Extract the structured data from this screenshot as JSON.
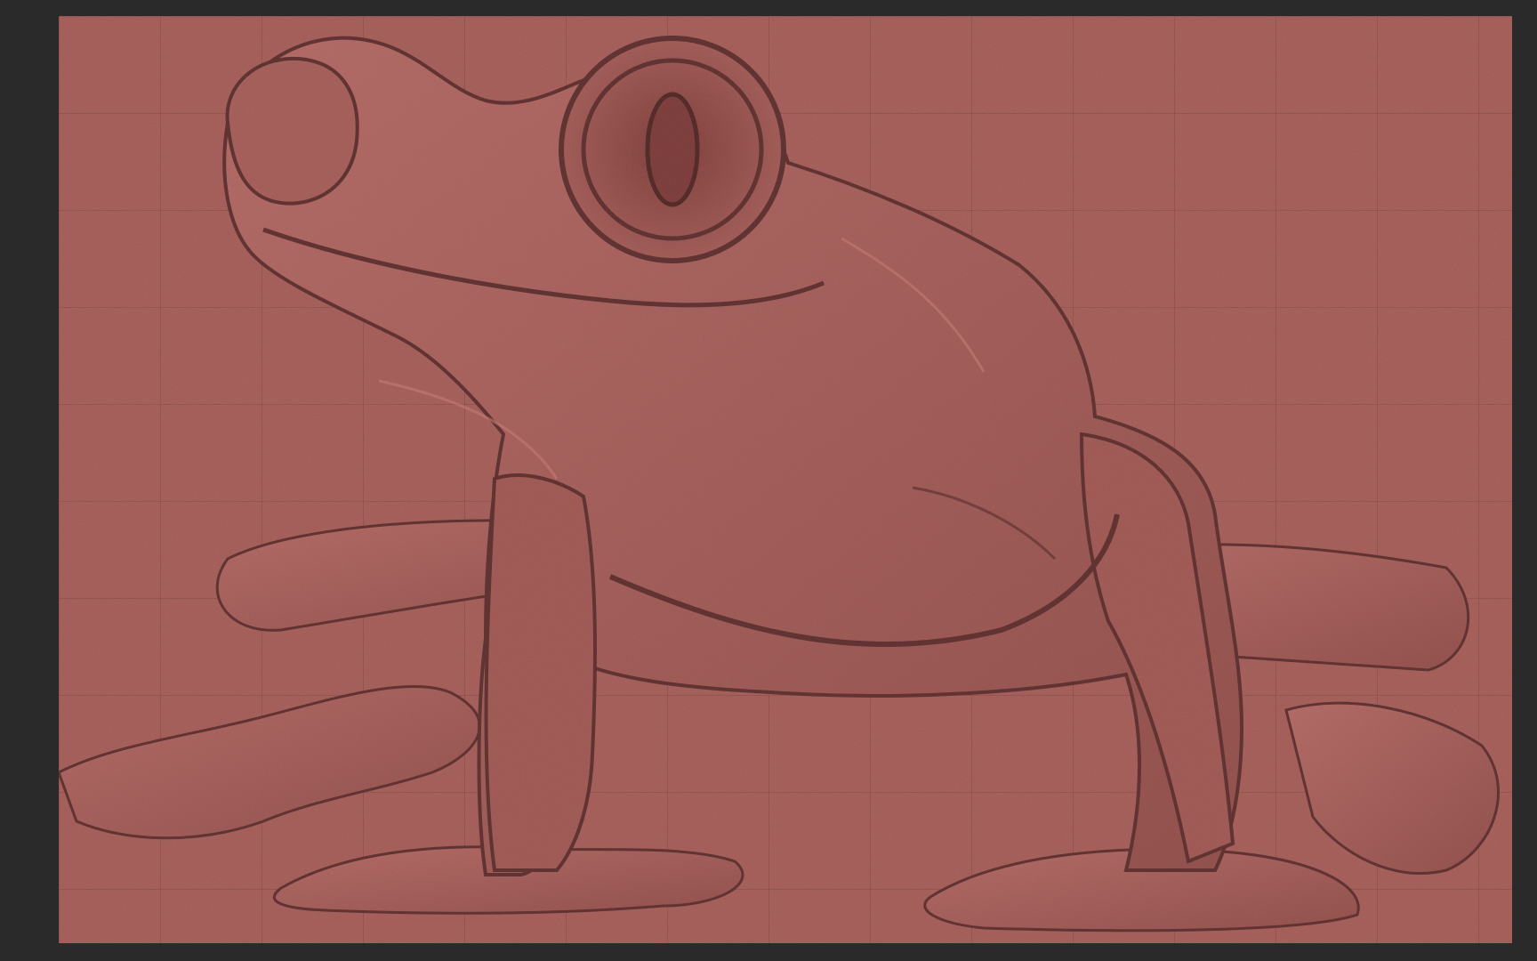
{
  "viewport": {
    "subject": "relief-frog-model",
    "material_color": "#a35a55",
    "background_color": "#2a2a2a",
    "grid_color": "#7f4340",
    "shadow_color": "#5a2c2a",
    "highlight_color": "#c47670"
  }
}
